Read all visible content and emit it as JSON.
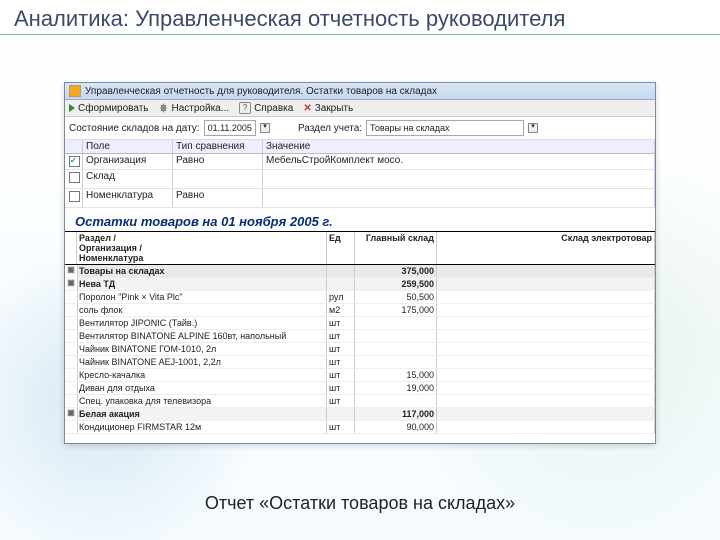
{
  "slide": {
    "title": "Аналитика: Управленческая отчетность руководителя",
    "caption": "Отчет «Остатки товаров на складах»"
  },
  "window": {
    "title": "Управленческая отчетность для руководителя. Остатки товаров на складах"
  },
  "toolbar": {
    "run": "Сформировать",
    "settings": "Настройка...",
    "help": "Справка",
    "close": "Закрыть"
  },
  "filters": {
    "date_label": "Состояние складов на дату:",
    "date_value": "01.11.2005",
    "section_label": "Раздел учета:",
    "section_value": "Товары на складах"
  },
  "filter_grid": {
    "headers": {
      "field": "Поле",
      "cmp": "Тип сравнения",
      "val": "Значение"
    },
    "rows": [
      {
        "checked": true,
        "field": "Организация",
        "cmp": "Равно",
        "val": "МебельСтройКомплект мосо."
      },
      {
        "checked": false,
        "field": "Склад",
        "cmp": "",
        "val": ""
      },
      {
        "checked": false,
        "field": "Номенклатура",
        "cmp": "Равно",
        "val": ""
      }
    ]
  },
  "report": {
    "title": "Остатки товаров на 01 ноября 2005 г.",
    "columns": {
      "c0": "",
      "c1": "Раздел /\nОрганизация /\nНоменклатура",
      "c2": "Ед",
      "c3": "Главный склад",
      "c4": "Склад электротовар"
    },
    "rows": [
      {
        "k": "group",
        "c1": "Товары на складах",
        "c2": "",
        "c3": "375,000",
        "c4": ""
      },
      {
        "k": "sub",
        "c1": "Нева ТД",
        "c2": "",
        "c3": "259,500",
        "c4": ""
      },
      {
        "k": "item",
        "c1": "Поролон \"Pink × Vita Plc\"",
        "c2": "рул",
        "c3": "50,500",
        "c4": ""
      },
      {
        "k": "item",
        "c1": "соль флок",
        "c2": "м2",
        "c3": "175,000",
        "c4": ""
      },
      {
        "k": "item",
        "c1": "Вентилятор JIPONIC (Тайв.)",
        "c2": "шт",
        "c3": "",
        "c4": ""
      },
      {
        "k": "item",
        "c1": "Вентилятор BINATONE ALPINE 160вт, напольный",
        "c2": "шт",
        "c3": "",
        "c4": ""
      },
      {
        "k": "item",
        "c1": "Чайник BINATONE ГОМ-1010, 2л",
        "c2": "шт",
        "c3": "",
        "c4": ""
      },
      {
        "k": "item",
        "c1": "Чайник BINATONE AEJ-1001, 2,2л",
        "c2": "шт",
        "c3": "",
        "c4": ""
      },
      {
        "k": "item",
        "c1": "Кресло-качалка",
        "c2": "шт",
        "c3": "15,000",
        "c4": ""
      },
      {
        "k": "item",
        "c1": "Диван для отдыха",
        "c2": "шт",
        "c3": "19,000",
        "c4": ""
      },
      {
        "k": "item",
        "c1": "Спец. упаковка для телевизора",
        "c2": "шт",
        "c3": "",
        "c4": ""
      },
      {
        "k": "sub",
        "c1": "Белая акация",
        "c2": "",
        "c3": "117,000",
        "c4": ""
      },
      {
        "k": "item",
        "c1": "Кондиционер FIRMSTAR 12м",
        "c2": "шт",
        "c3": "90,000",
        "c4": ""
      }
    ]
  },
  "chart_data": {
    "type": "table",
    "title": "Остатки товаров на 01 ноября 2005 г.",
    "columns": [
      "Раздел / Организация / Номенклатура",
      "Ед",
      "Главный склад",
      "Склад электротовар"
    ],
    "rows": [
      [
        "Товары на складах",
        "",
        375000,
        null
      ],
      [
        "Нева ТД",
        "",
        259500,
        null
      ],
      [
        "Поролон \"Pink × Vita Plc\"",
        "рул",
        50500,
        null
      ],
      [
        "соль флок",
        "м2",
        175000,
        null
      ],
      [
        "Вентилятор JIPONIC (Тайв.)",
        "шт",
        null,
        null
      ],
      [
        "Вентилятор BINATONE ALPINE 160вт, напольный",
        "шт",
        null,
        null
      ],
      [
        "Чайник BINATONE ГОМ-1010, 2л",
        "шт",
        null,
        null
      ],
      [
        "Чайник BINATONE AEJ-1001, 2,2л",
        "шт",
        null,
        null
      ],
      [
        "Кресло-качалка",
        "шт",
        15000,
        null
      ],
      [
        "Диван для отдыха",
        "шт",
        19000,
        null
      ],
      [
        "Спец. упаковка для телевизора",
        "шт",
        null,
        null
      ],
      [
        "Белая акация",
        "",
        117000,
        null
      ],
      [
        "Кондиционер FIRMSTAR 12м",
        "шт",
        90000,
        null
      ]
    ]
  }
}
